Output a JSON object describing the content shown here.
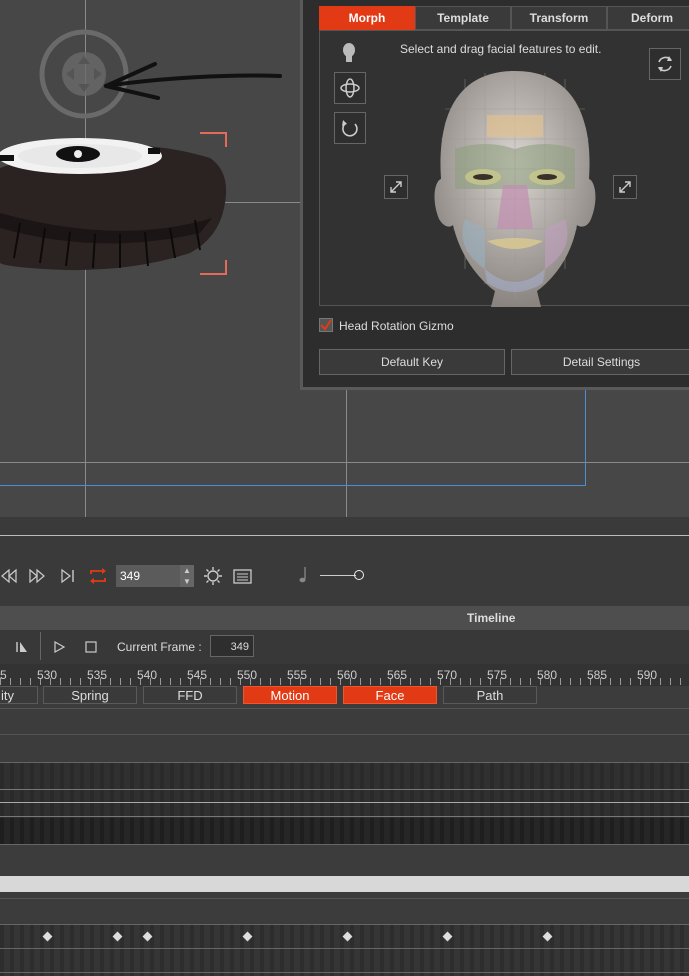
{
  "morph_panel": {
    "tabs": [
      {
        "label": "Morph",
        "active": true
      },
      {
        "label": "Template",
        "active": false
      },
      {
        "label": "Transform",
        "active": false
      },
      {
        "label": "Deform",
        "active": false
      }
    ],
    "instruction": "Select and drag facial features to edit.",
    "head_rotation_gizmo": {
      "label": "Head Rotation Gizmo",
      "checked": true
    },
    "default_key_label": "Default Key",
    "detail_settings_label": "Detail Settings"
  },
  "playback": {
    "frame_value": "349",
    "icons": [
      "rewind-icon",
      "fast-forward-icon",
      "next-frame-icon",
      "loop-icon",
      "sun-icon",
      "panel-icon",
      "music-note-icon"
    ]
  },
  "timeline": {
    "title": "Timeline",
    "current_frame_label": "Current Frame :",
    "current_frame_value": "349",
    "ruler_ticks": [
      "5",
      "530",
      "535",
      "540",
      "545",
      "550",
      "555",
      "560",
      "565",
      "570",
      "575",
      "580",
      "585",
      "590"
    ],
    "track_tabs": [
      {
        "label": "ity",
        "active": false
      },
      {
        "label": "Spring",
        "active": false
      },
      {
        "label": "FFD",
        "active": false
      },
      {
        "label": "Motion",
        "active": true
      },
      {
        "label": "Face",
        "active": true
      },
      {
        "label": "Path",
        "active": false
      }
    ]
  },
  "colors": {
    "accent": "#e23a14",
    "panel_bg": "#2d2d2d",
    "viewport_bg": "#474747"
  }
}
